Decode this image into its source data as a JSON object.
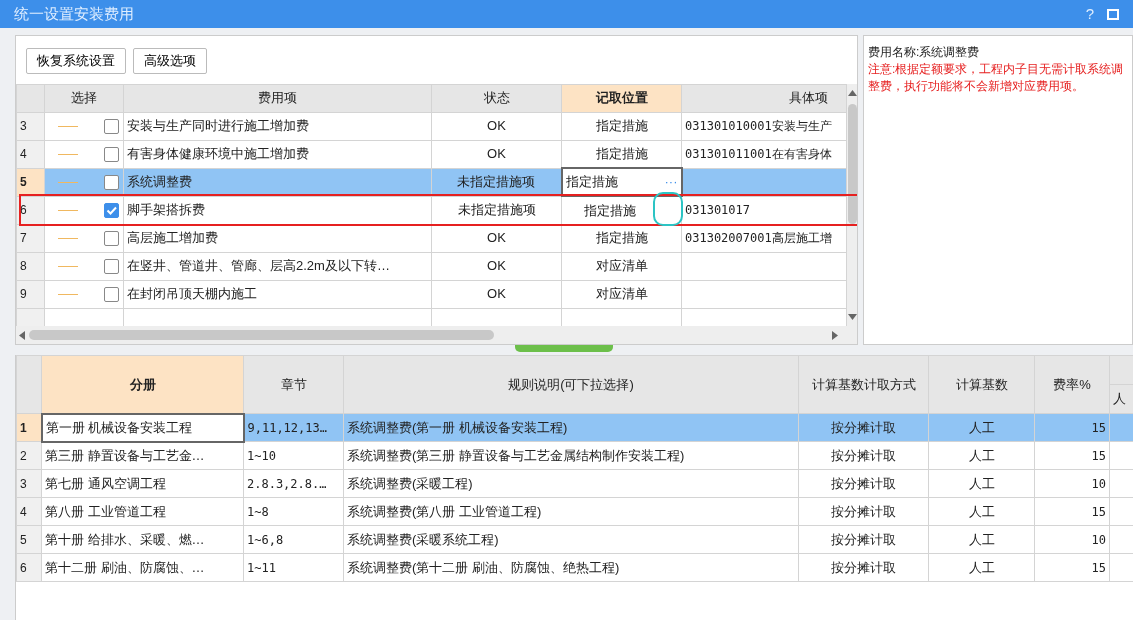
{
  "window": {
    "title": "统一设置安装费用",
    "help": "?"
  },
  "toolbar": {
    "buttons": [
      "恢复系统设置",
      "高级选项"
    ]
  },
  "fee_grid": {
    "columns": [
      {
        "label": "选择",
        "sorted": false
      },
      {
        "label": "费用项",
        "sorted": false
      },
      {
        "label": "状态",
        "sorted": false
      },
      {
        "label": "记取位置",
        "sorted": true
      },
      {
        "label": "具体项",
        "sorted": false
      }
    ],
    "rows": [
      {
        "number": "3",
        "checked": false,
        "selected": false,
        "item": "安装与生产同时进行施工增加费",
        "status": "OK",
        "location": "指定措施",
        "detail": "031301010001安装与生产",
        "editing": false,
        "boxed": false,
        "circled": false
      },
      {
        "number": "4",
        "checked": false,
        "selected": false,
        "item": "有害身体健康环境中施工增加费",
        "status": "OK",
        "location": "指定措施",
        "detail": "031301011001在有害身体",
        "editing": false,
        "boxed": false,
        "circled": false
      },
      {
        "number": "5",
        "checked": false,
        "selected": true,
        "item": "系统调整费",
        "status": "未指定措施项",
        "location": "指定措施",
        "edit_button": "···",
        "editing": true,
        "boxed": false,
        "circled": false
      },
      {
        "number": "6",
        "checked": true,
        "selected": false,
        "item": "脚手架搭拆费",
        "status": "未指定措施项",
        "location": "指定措施",
        "detail": "031301017",
        "editing": false,
        "boxed": true,
        "circled": true
      },
      {
        "number": "7",
        "checked": false,
        "selected": false,
        "item": "高层施工增加费",
        "status": "OK",
        "location": "指定措施",
        "detail": "031302007001高层施工增",
        "editing": false,
        "boxed": false,
        "circled": false
      },
      {
        "number": "8",
        "checked": false,
        "selected": false,
        "item": "在竖井、管道井、管廊、层高2.2m及以下转…",
        "status": "OK",
        "location": "对应清单",
        "editing": false,
        "boxed": false,
        "circled": false
      },
      {
        "number": "9",
        "checked": false,
        "selected": false,
        "item": "在封闭吊顶天棚内施工",
        "status": "OK",
        "location": "对应清单",
        "editing": false,
        "boxed": false,
        "circled": false
      }
    ]
  },
  "info_panel": {
    "name_line": "费用名称:系统调整费",
    "warning": "注意:根据定额要求，工程内子目无需计取系统调整费，执行功能将不会新增对应费用项。"
  },
  "rule_grid": {
    "columns": [
      {
        "label": "分册",
        "sorted": true
      },
      {
        "label": "章节",
        "sorted": false
      },
      {
        "label": "规则说明(可下拉选择)",
        "sorted": false
      },
      {
        "label": "计算基数计取方式",
        "sorted": false
      },
      {
        "label": "计算基数",
        "sorted": false
      },
      {
        "label": "费率%",
        "sorted": false
      }
    ],
    "column_7_sub": "人",
    "rows": [
      {
        "number": "1",
        "selected": true,
        "volume": "第一册 机械设备安装工程",
        "chapter": "9,11,12,13…",
        "rule": "系统调整费(第一册 机械设备安装工程)",
        "method": "按分摊计取",
        "base": "人工",
        "rate": "15"
      },
      {
        "number": "2",
        "selected": false,
        "volume": "第三册 静置设备与工艺金…",
        "chapter": "1~10",
        "rule": "系统调整费(第三册 静置设备与工艺金属结构制作安装工程)",
        "method": "按分摊计取",
        "base": "人工",
        "rate": "15"
      },
      {
        "number": "3",
        "selected": false,
        "volume": "第七册 通风空调工程",
        "chapter": "2.8.3,2.8.…",
        "rule": "系统调整费(采暖工程)",
        "method": "按分摊计取",
        "base": "人工",
        "rate": "10"
      },
      {
        "number": "4",
        "selected": false,
        "volume": "第八册 工业管道工程",
        "chapter": "1~8",
        "rule": "系统调整费(第八册 工业管道工程)",
        "method": "按分摊计取",
        "base": "人工",
        "rate": "15"
      },
      {
        "number": "5",
        "selected": false,
        "volume": "第十册 给排水、采暖、燃…",
        "chapter": "1~6,8",
        "rule": "系统调整费(采暖系统工程)",
        "method": "按分摊计取",
        "base": "人工",
        "rate": "10"
      },
      {
        "number": "6",
        "selected": false,
        "volume": "第十二册 刷油、防腐蚀、…",
        "chapter": "1~11",
        "rule": "系统调整费(第十二册 刷油、防腐蚀、绝热工程)",
        "method": "按分摊计取",
        "base": "人工",
        "rate": "15"
      }
    ]
  }
}
